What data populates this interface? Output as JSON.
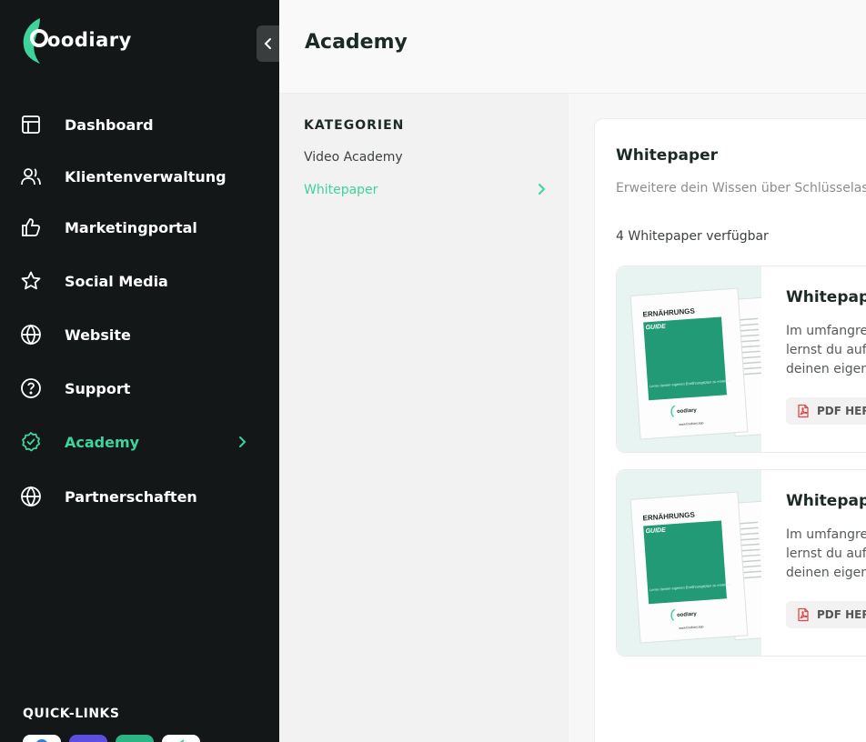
{
  "sidebar": {
    "logo_text": "oodiary",
    "nav": [
      {
        "label": "Dashboard",
        "icon": "layout-icon"
      },
      {
        "label": "Klientenverwaltung",
        "icon": "users-icon"
      },
      {
        "label": "Marketingportal",
        "icon": "thumbs-up-icon"
      },
      {
        "label": "Social Media",
        "icon": "star-icon"
      },
      {
        "label": "Website",
        "icon": "globe-icon"
      },
      {
        "label": "Support",
        "icon": "help-circle-icon"
      },
      {
        "label": "Academy",
        "icon": "badge-check-icon",
        "active": true
      },
      {
        "label": "Partnerschaften",
        "icon": "globe-icon"
      }
    ],
    "quicklinks_title": "QUICK-LINKS",
    "accent_color": "#3ed39b"
  },
  "header": {
    "title": "Academy"
  },
  "categories": {
    "title": "KATEGORIEN",
    "items": [
      {
        "label": "Video Academy"
      },
      {
        "label": "Whitepaper",
        "active": true
      }
    ]
  },
  "panel": {
    "title": "Whitepaper",
    "description": "Erweitere dein Wissen über Schlüsselasp",
    "count": "4 Whitepaper verfügbar",
    "cards": [
      {
        "title": "Whitepape",
        "desc_lines": [
          "Im umfangrei",
          "lernst du auf",
          "deinen eigene"
        ],
        "button": "PDF HERU",
        "cover": {
          "heading": "ERNÄHRUNGS",
          "sub": "GUIDE",
          "tagline": "Lerne deinen eigenen Ernährungsplan zu erstellen",
          "brand": "oodiary",
          "url": "www.foodiary.app"
        }
      },
      {
        "title": "Whitepape",
        "desc_lines": [
          "Im umfangrei",
          "lernst du auf",
          "deinen eigene"
        ],
        "button": "PDF HERU",
        "cover": {
          "heading": "ERNÄHRUNGS",
          "sub": "GUIDE",
          "tagline": "Lerne deinen eigenen Ernährungsplan zu erstellen",
          "brand": "oodiary",
          "url": "www.foodiary.app"
        }
      }
    ]
  }
}
